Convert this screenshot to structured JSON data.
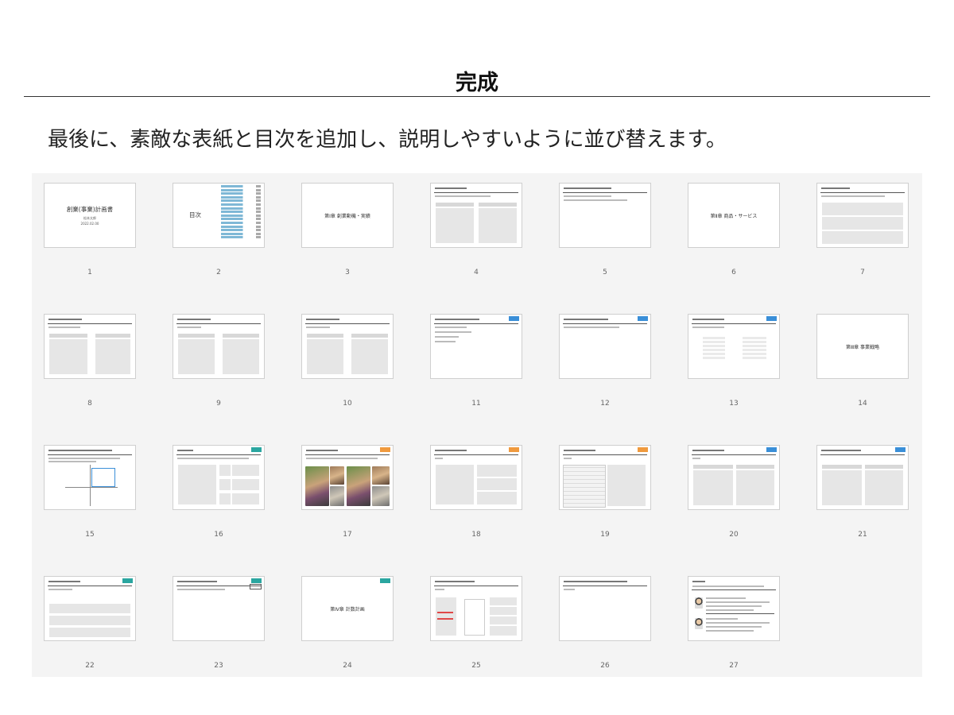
{
  "header": {
    "title": "完成",
    "subtitle": "最後に、素敵な表紙と目次を追加し、説明しやすいように並び替えます。"
  },
  "slides": [
    {
      "num": "1",
      "title": "創業(事業)計画書",
      "sub1": "松本太郎",
      "sub2": "2022.02.00"
    },
    {
      "num": "2",
      "title": "目次"
    },
    {
      "num": "3",
      "title": "第Ⅰ章 創業動機・実績"
    },
    {
      "num": "4"
    },
    {
      "num": "5"
    },
    {
      "num": "6",
      "title": "第Ⅱ章 商品・サービス"
    },
    {
      "num": "7"
    },
    {
      "num": "8"
    },
    {
      "num": "9"
    },
    {
      "num": "10"
    },
    {
      "num": "11"
    },
    {
      "num": "12"
    },
    {
      "num": "13"
    },
    {
      "num": "14",
      "title": "第Ⅲ章 事業戦略"
    },
    {
      "num": "15"
    },
    {
      "num": "16"
    },
    {
      "num": "17"
    },
    {
      "num": "18"
    },
    {
      "num": "19"
    },
    {
      "num": "20"
    },
    {
      "num": "21"
    },
    {
      "num": "22"
    },
    {
      "num": "23"
    },
    {
      "num": "24",
      "title": "第Ⅳ章 計数計画"
    },
    {
      "num": "25"
    },
    {
      "num": "26"
    },
    {
      "num": "27"
    }
  ],
  "colors": {
    "accent_blue": "#3a8fd8",
    "accent_orange": "#f09a3e",
    "accent_teal": "#2aa6a0"
  }
}
